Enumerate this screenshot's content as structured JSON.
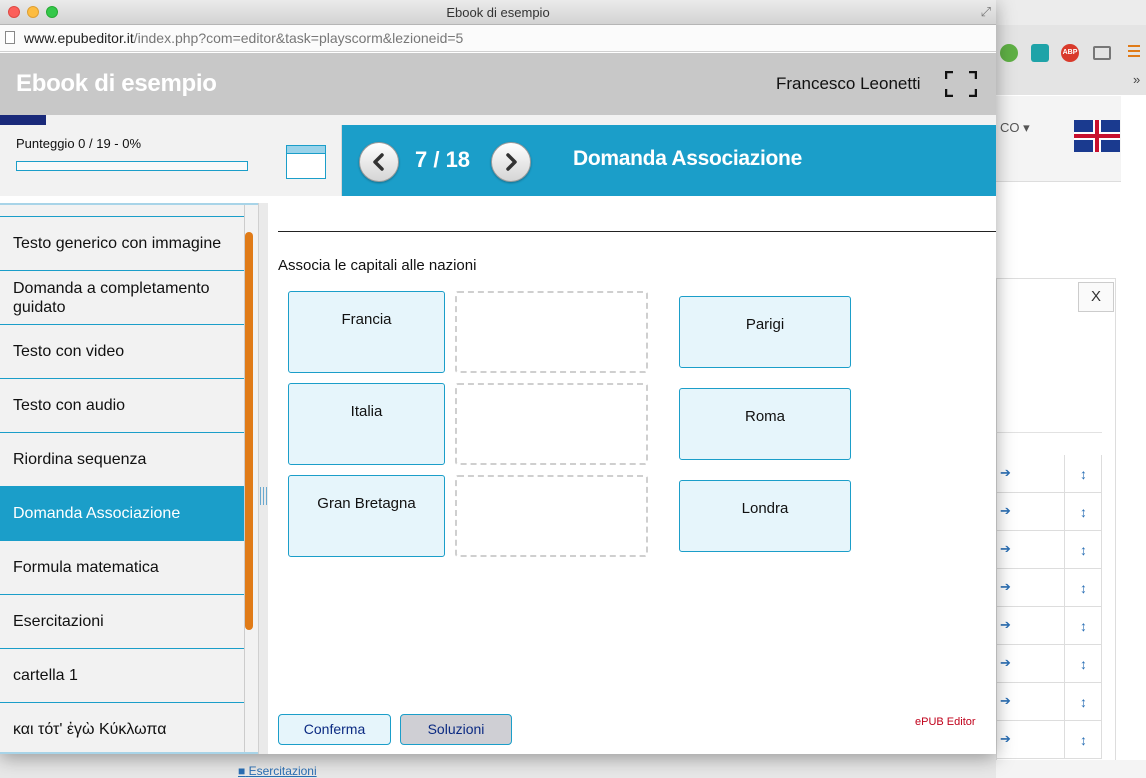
{
  "window": {
    "title": "Ebook di esempio",
    "url_domain": "www.epubeditor.it",
    "url_path": "/index.php?com=editor&task=playscorm&lezioneid=5"
  },
  "header": {
    "app_title": "Ebook di esempio",
    "user_name": "Francesco Leonetti"
  },
  "score": {
    "label": "Punteggio 0 / 19 - 0%",
    "progress_fraction": 0.0
  },
  "navigation": {
    "page_counter": "7 / 18",
    "section_title": "Domanda Associazione"
  },
  "sidebar": {
    "items": [
      {
        "label": "Testo generico con immagine",
        "active": false
      },
      {
        "label": "Domanda a completamento guidato",
        "active": false
      },
      {
        "label": "Testo con video",
        "active": false
      },
      {
        "label": "Testo con audio",
        "active": false
      },
      {
        "label": "Riordina sequenza",
        "active": false
      },
      {
        "label": "Domanda Associazione",
        "active": true
      },
      {
        "label": "Formula matematica",
        "active": false
      },
      {
        "label": "Esercitazioni",
        "active": false
      },
      {
        "label": "cartella 1",
        "active": false
      },
      {
        "label": "και τότ' ἐγὼ Κύκλωπα",
        "active": false
      }
    ]
  },
  "exercise": {
    "prompt": "Associa le capitali alle nazioni",
    "nations": [
      "Francia",
      "Italia",
      "Gran Bretagna"
    ],
    "capitals": [
      "Parigi",
      "Roma",
      "Londra"
    ]
  },
  "actions": {
    "confirm_label": "Conferma",
    "solutions_label": "Soluzioni"
  },
  "footer": {
    "brand": "ePUB Editor"
  },
  "background": {
    "close_label": "X",
    "user_fragment": "CO",
    "folder_link": "Esercitazioni"
  },
  "colors": {
    "accent": "#1b9ec9",
    "scrollbar": "#e07b18",
    "header_gray": "#c8c8c8",
    "card_fill": "#e6f5fb",
    "brand_red": "#c0001a"
  }
}
